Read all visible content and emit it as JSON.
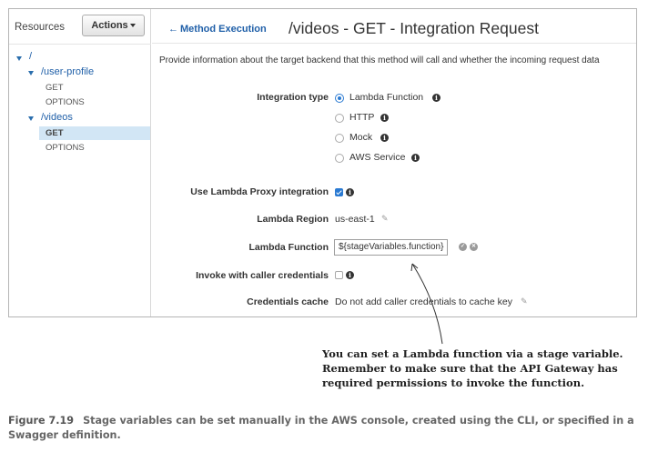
{
  "sidebar": {
    "title": "Resources",
    "actions_label": "Actions",
    "tree": [
      {
        "label": "/"
      },
      {
        "label": "/user-profile",
        "methods": [
          "GET",
          "OPTIONS"
        ]
      },
      {
        "label": "/videos",
        "methods": [
          "GET",
          "OPTIONS"
        ],
        "selected_method": "GET"
      }
    ]
  },
  "header": {
    "back_label": "Method Execution",
    "title": "/videos - GET - Integration Request"
  },
  "intro": "Provide information about the target backend that this method will call and whether the incoming request data",
  "form": {
    "integration_type_label": "Integration type",
    "integration_options": [
      "Lambda Function",
      "HTTP",
      "Mock",
      "AWS Service"
    ],
    "integration_selected": "Lambda Function",
    "proxy_label": "Use Lambda Proxy integration",
    "proxy_checked": true,
    "region_label": "Lambda Region",
    "region_value": "us-east-1",
    "function_label": "Lambda Function",
    "function_value": "${stageVariables.function}",
    "invoke_label": "Invoke with caller credentials",
    "invoke_checked": false,
    "cache_label": "Credentials cache",
    "cache_value": "Do not add caller credentials to cache key"
  },
  "callout": [
    "You can set a Lambda function via a stage variable.",
    "Remember to make sure that the API Gateway has",
    "required permissions to invoke the function."
  ],
  "caption": {
    "figure_number": "Figure 7.19",
    "text": "Stage variables can be set manually in the AWS console, created using the CLI, or specified in a Swagger definition."
  },
  "colors": {
    "link": "#1f5fa8",
    "selected_row": "#d2e6f5",
    "accent": "#2a7ad2"
  }
}
